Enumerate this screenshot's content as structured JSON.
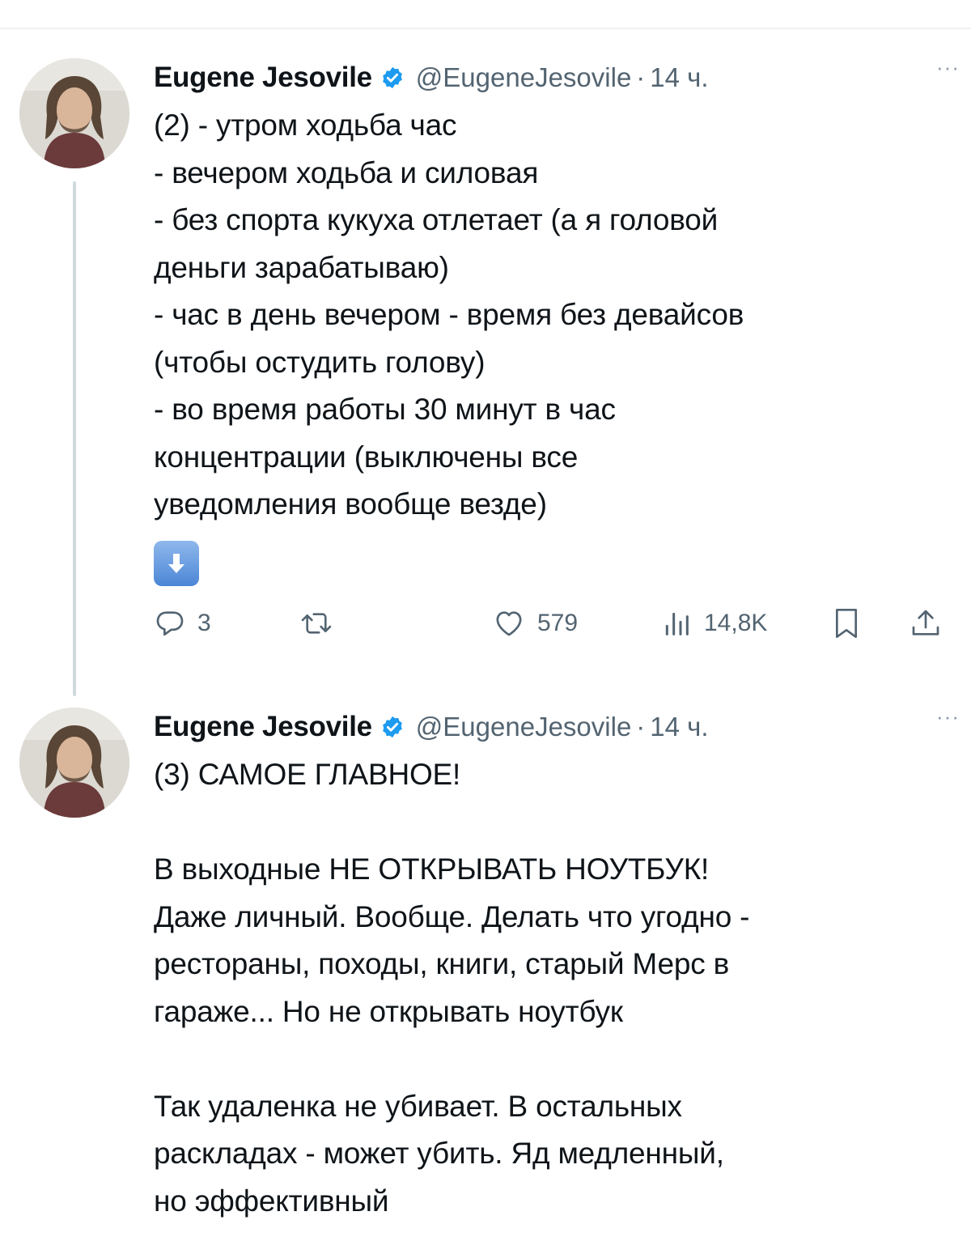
{
  "tweets": [
    {
      "author_name": "Eugene Jesovile",
      "handle": "@EugeneJesovile",
      "separator": "·",
      "time": "14 ч.",
      "more_label": "···",
      "lines": [
        "(2) - утром ходьба час",
        "- вечером ходьба и силовая",
        "- без спорта кукуха отлетает (а я головой",
        "деньги зарабатываю)",
        "- час в день вечером - время без девайсов",
        "(чтобы остудить голову)",
        "- во время работы 30 минут в час",
        "концентрации (выключены все",
        "уведомления вообще везде)"
      ],
      "emoji": "arrow-down-emoji",
      "stats": {
        "replies": "3",
        "likes": "579",
        "views": "14,8K"
      }
    },
    {
      "author_name": "Eugene Jesovile",
      "handle": "@EugeneJesovile",
      "separator": "·",
      "time": "14 ч.",
      "more_label": "···",
      "lines": [
        "(3) САМОЕ ГЛАВНОЕ!",
        "",
        "В выходные НЕ ОТКРЫВАТЬ НОУТБУК!",
        "Даже личный. Вообще. Делать что угодно -",
        "рестораны, походы, книги, старый Мерс в",
        "гараже... Но не открывать ноутбук",
        "",
        "Так удаленка не убивает. В остальных",
        "раскладах - может убить. Яд медленный,",
        "но эффективный"
      ]
    }
  ],
  "colors": {
    "verified": "#1d9bf0",
    "secondary_text": "#536471",
    "thread_line": "#cfd9de"
  }
}
